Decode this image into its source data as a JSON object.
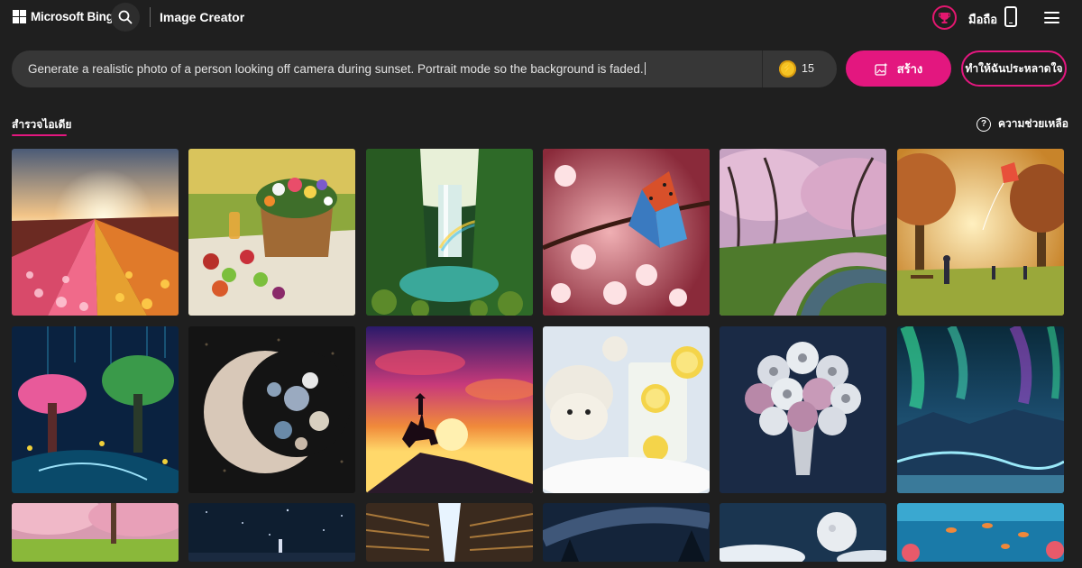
{
  "header": {
    "brand": "Microsoft Bing",
    "app_title": "Image Creator",
    "mobile_label": "มือถือ"
  },
  "prompt": {
    "text": "Generate a realistic photo of a person looking off camera during sunset. Portrait mode so the background is faded.",
    "coins": "15",
    "create_label": "สร้าง",
    "surprise_label": "ทำให้ฉันประหลาดใจ"
  },
  "explore": {
    "tab_label": "สำรวจไอเดีย",
    "help_label": "ความช่วยเหลือ"
  },
  "colors": {
    "accent": "#e3177f",
    "background": "#1f1f1f"
  },
  "gallery": {
    "rows": [
      [
        "tulip field at sunrise",
        "picnic basket with flowers and fruit",
        "jungle waterfall with rainbow",
        "butterfly on cherry blossoms",
        "cherry blossom park with stream",
        "child flying a kite in park"
      ],
      [
        "glowing fantasy forest",
        "crescent moon with flowers",
        "cowboy on horse at sunset",
        "polar bears with lemonade",
        "silver flower bouquet",
        "aurora over frozen landscape"
      ],
      [
        "pink blossom garden",
        "starry night sky",
        "endless library corridor",
        "milky way over trees",
        "full moon over clouds",
        "coral reef with fish"
      ]
    ]
  }
}
